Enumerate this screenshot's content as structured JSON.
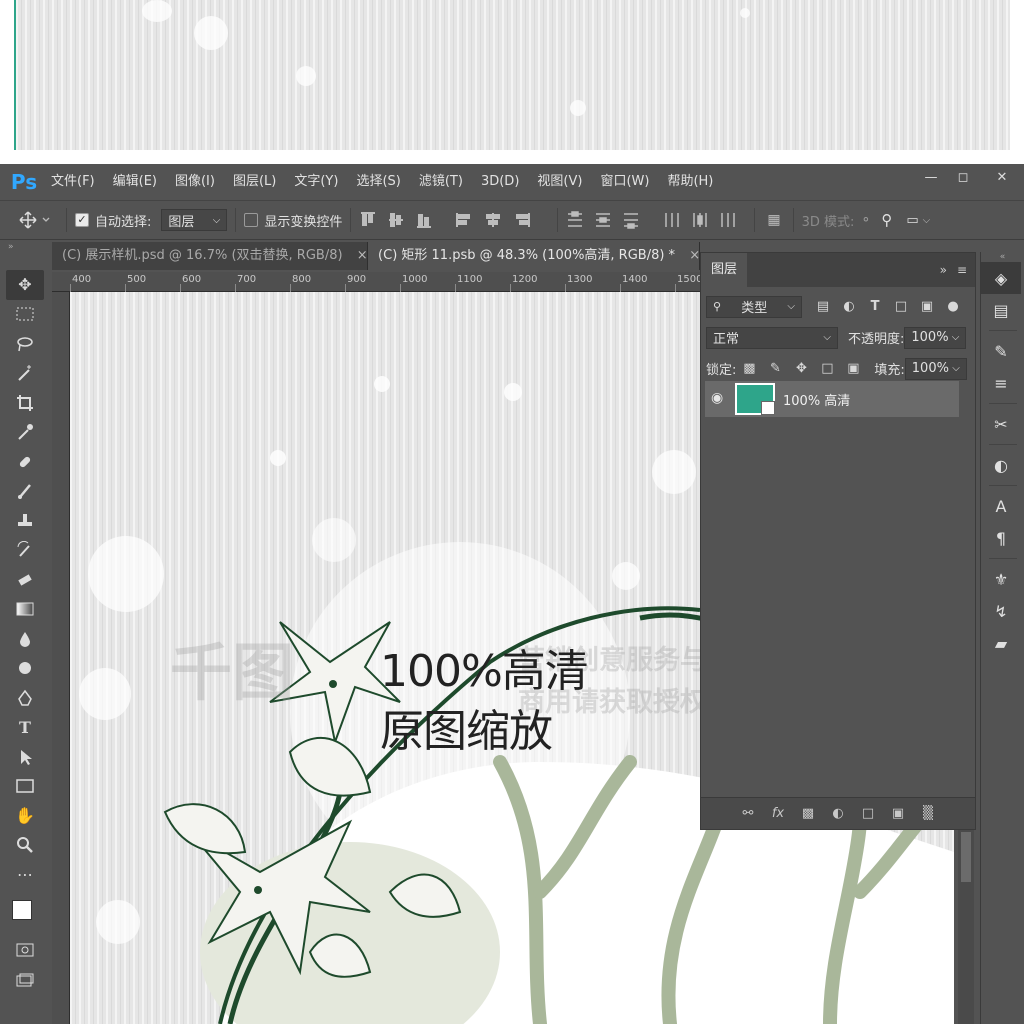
{
  "menubar": {
    "logo": "Ps",
    "items": [
      "文件(F)",
      "编辑(E)",
      "图像(I)",
      "图层(L)",
      "文字(Y)",
      "选择(S)",
      "滤镜(T)",
      "3D(D)",
      "视图(V)",
      "窗口(W)",
      "帮助(H)"
    ]
  },
  "options": {
    "auto_select_label": "自动选择:",
    "auto_select_target": "图层",
    "show_transform_label": "显示变换控件",
    "mode_3d_label": "3D 模式:"
  },
  "tabs": [
    {
      "label": "(C) 展示样机.psd @ 16.7% (双击替换, RGB/8)"
    },
    {
      "label": "(C) 矩形 11.psb @ 48.3% (100%高清, RGB/8) *"
    }
  ],
  "ruler": {
    "h_ticks": [
      "400",
      "500",
      "600",
      "700",
      "800",
      "900",
      "1000",
      "1100",
      "1200",
      "1300",
      "1400",
      "1500"
    ]
  },
  "canvas": {
    "overlay_line1": "100%高清",
    "overlay_line2": "原图缩放",
    "watermark_brand": "千图",
    "watermark_line1": "营销创意服务与协作平台",
    "watermark_line2": "商用请获取授权"
  },
  "layers_panel": {
    "tab_title": "图层",
    "filter_label": "类型",
    "blend_mode": "正常",
    "opacity_label": "不透明度:",
    "opacity_value": "100%",
    "lock_label": "锁定:",
    "fill_label": "填充:",
    "fill_value": "100%",
    "layer_name": "100% 高清",
    "layer_thumb_color": "#2ea58a"
  },
  "colors": {
    "ps_blue": "#31a8ff",
    "ui_gray": "#535353",
    "accent_green": "#2ea58a",
    "flower_dark": "#1e4a2c",
    "branch_sage": "#a9b79a"
  }
}
